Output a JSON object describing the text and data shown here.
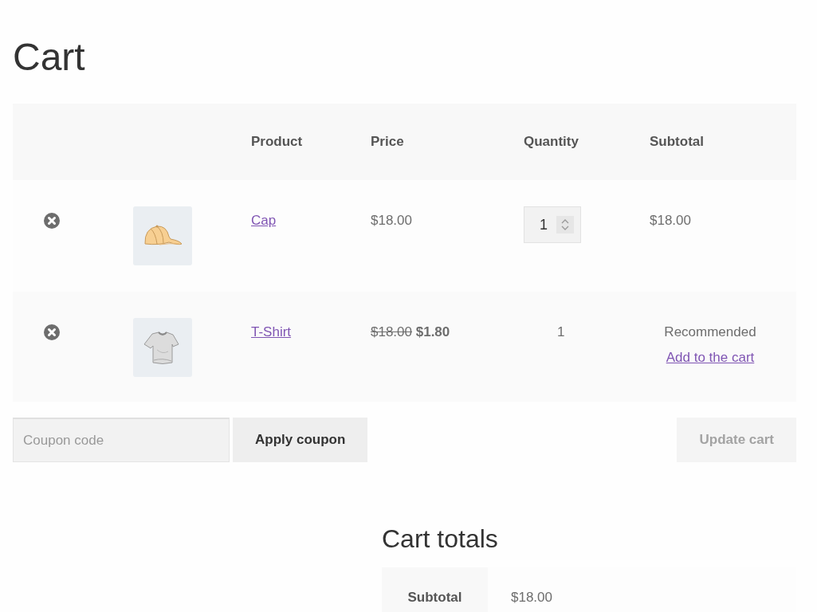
{
  "title": "Cart",
  "table": {
    "columns": [
      "Product",
      "Price",
      "Quantity",
      "Subtotal"
    ],
    "rows": [
      {
        "kind": "standard",
        "product": "Cap",
        "price": "$18.00",
        "quantity": "1",
        "subtotal": "$18.00"
      },
      {
        "kind": "offer",
        "product": "T-Shirt",
        "regular_price": "$18.00",
        "price": "$1.80",
        "quantity": "1",
        "note": "Recommended",
        "action": "Add to the cart"
      }
    ]
  },
  "coupon": {
    "placeholder": "Coupon code"
  },
  "buttons": [
    {
      "label": "Apply coupon",
      "disabled": false
    },
    {
      "label": "Update cart",
      "disabled": true
    }
  ],
  "totals": {
    "title": "Cart totals",
    "rows": [
      {
        "label": "Subtotal",
        "value": "$18.00"
      }
    ]
  }
}
